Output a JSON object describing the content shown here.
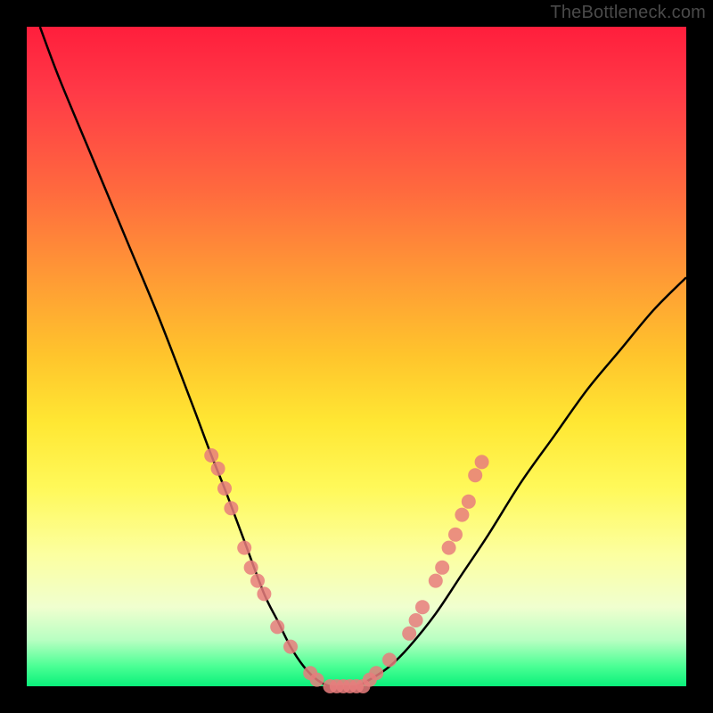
{
  "watermark": "TheBottleneck.com",
  "chart_data": {
    "type": "line",
    "title": "",
    "xlabel": "",
    "ylabel": "",
    "xlim": [
      0,
      100
    ],
    "ylim": [
      0,
      100
    ],
    "background_gradient": {
      "top_color": "#ff1e3c",
      "mid_color": "#ffe733",
      "bottom_color": "#0af07a",
      "meaning": "bottleneck severity (red=high, green=optimal)"
    },
    "series": [
      {
        "name": "bottleneck-curve",
        "x": [
          2,
          5,
          10,
          15,
          20,
          25,
          28,
          30,
          33,
          36,
          38,
          40,
          42,
          44,
          46,
          48,
          50,
          52,
          55,
          58,
          62,
          66,
          70,
          75,
          80,
          85,
          90,
          95,
          100
        ],
        "values": [
          100,
          92,
          80,
          68,
          56,
          43,
          35,
          30,
          22,
          14,
          10,
          6,
          3,
          1,
          0,
          0,
          0,
          1,
          3,
          6,
          11,
          17,
          23,
          31,
          38,
          45,
          51,
          57,
          62
        ]
      }
    ],
    "markers": {
      "name": "highlighted-points",
      "color": "#e77d7d",
      "points": [
        {
          "x": 28,
          "y": 35
        },
        {
          "x": 29,
          "y": 33
        },
        {
          "x": 30,
          "y": 30
        },
        {
          "x": 31,
          "y": 27
        },
        {
          "x": 33,
          "y": 21
        },
        {
          "x": 34,
          "y": 18
        },
        {
          "x": 35,
          "y": 16
        },
        {
          "x": 36,
          "y": 14
        },
        {
          "x": 38,
          "y": 9
        },
        {
          "x": 40,
          "y": 6
        },
        {
          "x": 43,
          "y": 2
        },
        {
          "x": 44,
          "y": 1
        },
        {
          "x": 46,
          "y": 0
        },
        {
          "x": 47,
          "y": 0
        },
        {
          "x": 48,
          "y": 0
        },
        {
          "x": 49,
          "y": 0
        },
        {
          "x": 50,
          "y": 0
        },
        {
          "x": 51,
          "y": 0
        },
        {
          "x": 52,
          "y": 1
        },
        {
          "x": 53,
          "y": 2
        },
        {
          "x": 55,
          "y": 4
        },
        {
          "x": 58,
          "y": 8
        },
        {
          "x": 59,
          "y": 10
        },
        {
          "x": 60,
          "y": 12
        },
        {
          "x": 62,
          "y": 16
        },
        {
          "x": 63,
          "y": 18
        },
        {
          "x": 64,
          "y": 21
        },
        {
          "x": 65,
          "y": 23
        },
        {
          "x": 66,
          "y": 26
        },
        {
          "x": 67,
          "y": 28
        },
        {
          "x": 68,
          "y": 32
        },
        {
          "x": 69,
          "y": 34
        }
      ]
    }
  }
}
